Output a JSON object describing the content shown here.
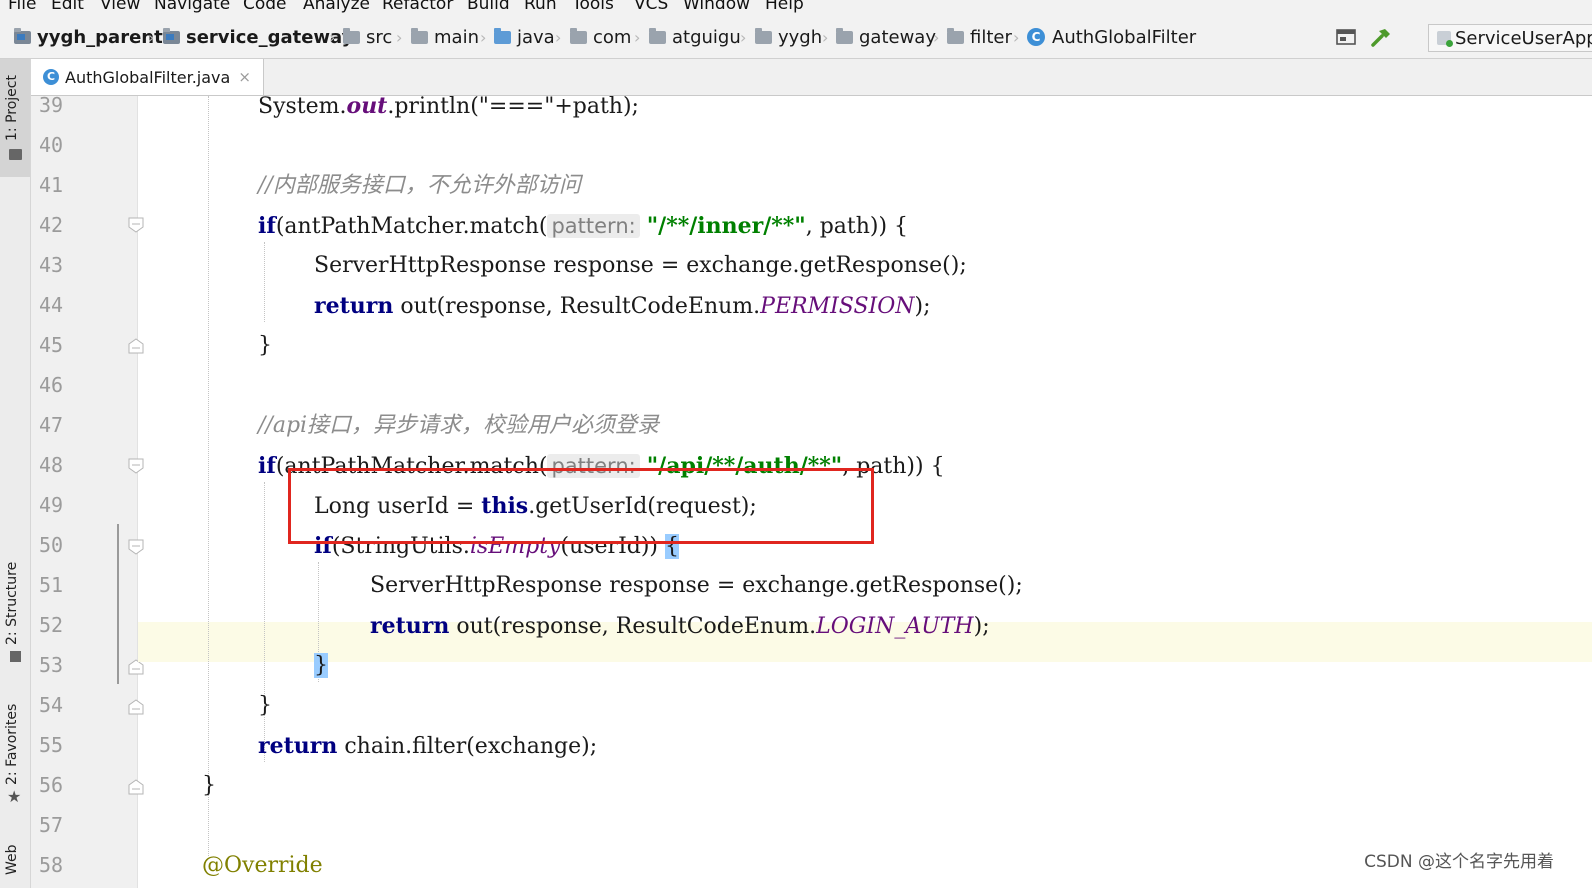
{
  "menu": [
    "File",
    "Edit",
    "View",
    "Navigate",
    "Code",
    "Analyze",
    "Refactor",
    "Build",
    "Run",
    "Tools",
    "VCS",
    "Window",
    "Help"
  ],
  "breadcrumbs": [
    "yygh_parent",
    "service_gateway",
    "src",
    "main",
    "java",
    "com",
    "atguigu",
    "yygh",
    "gateway",
    "filter",
    "AuthGlobalFilter"
  ],
  "run_config": "ServiceUserApp",
  "tool_tabs": {
    "project": "1: Project",
    "structure": "2: Structure",
    "favorites": "2: Favorites",
    "web": "Web"
  },
  "editor_tab": {
    "file_name": "AuthGlobalFilter.java",
    "close": "×"
  },
  "line_numbers": [
    "39",
    "40",
    "41",
    "42",
    "43",
    "44",
    "45",
    "46",
    "47",
    "48",
    "49",
    "50",
    "51",
    "52",
    "53",
    "54",
    "55",
    "56",
    "57",
    "58"
  ],
  "code": {
    "l39": {
      "a": "System.",
      "b": "out",
      "c": ".println(\"===\"+path);"
    },
    "l41": "//内部服务接口，不允许外部访问",
    "l42": {
      "kw": "if",
      "obj": "(antPathMatcher.match(",
      "hint": "pattern:",
      "str": "\"/**/inner/**\"",
      "rest": ", path)) {"
    },
    "l43": "ServerHttpResponse response = exchange.getResponse();",
    "l44": {
      "kw": "return",
      "mid": " out(response, ResultCodeEnum.",
      "cst": "PERMISSION",
      "end": ");"
    },
    "l45": "}",
    "l47": "//api接口，异步请求，校验用户必须登录",
    "l48": {
      "kw": "if",
      "obj": "(antPathMatcher.match(",
      "hint": "pattern:",
      "str": "\"/api/**/auth/**\"",
      "rest": ", path)) {"
    },
    "l49": {
      "a": "Long userId = ",
      "kw": "this",
      "b": ".getUserId(request);"
    },
    "l50": {
      "kw": "if",
      "a": "(StringUtils.",
      "it": "isEmpty",
      "b": "(userId)) ",
      "brace": "{"
    },
    "l51": "ServerHttpResponse response = exchange.getResponse();",
    "l52": {
      "kw": "return",
      "mid": " out(response, ResultCodeEnum.",
      "cst": "LOGIN_AUTH",
      "end": ");"
    },
    "l53": "}",
    "l54": "}",
    "l55": {
      "kw": "return",
      "rest": " chain.filter(exchange);"
    },
    "l56": "}",
    "l58": "@Override"
  },
  "watermark": "CSDN @这个名字先用着",
  "colors": {
    "keyword": "#000080",
    "string": "#008000",
    "comment": "#8c8c8c",
    "constant": "#660e7a",
    "highlight_box": "#e0261f",
    "caret_line": "#fcfbe6"
  }
}
